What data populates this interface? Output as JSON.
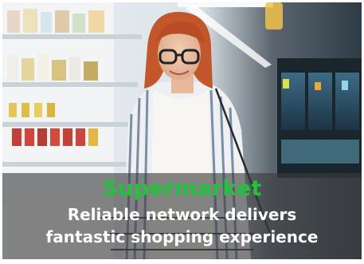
{
  "card": {
    "category": "Supermarket",
    "headline_line1": "Reliable network delivers",
    "headline_line2": "fantastic shopping experience"
  },
  "colors": {
    "category_green": "#1fc43a",
    "caption_overlay": "#3c3c3c",
    "headline_text": "#ffffff"
  }
}
